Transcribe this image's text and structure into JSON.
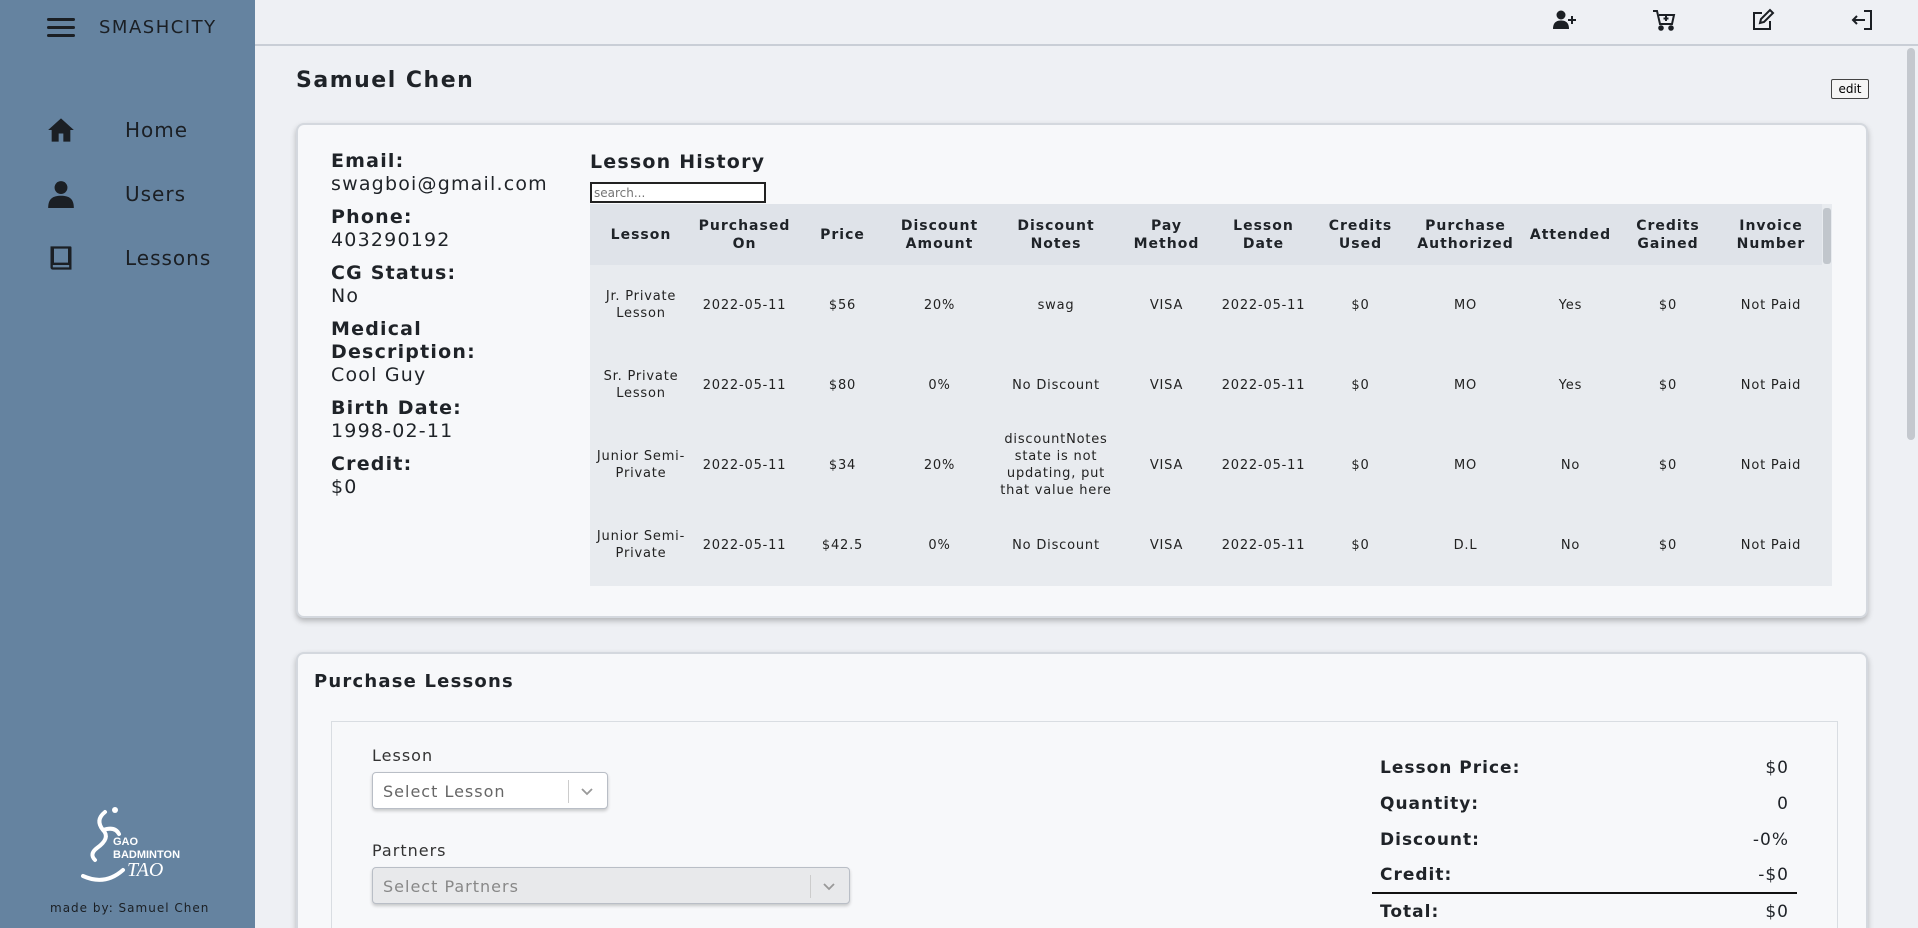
{
  "app": {
    "title": "SMASHCITY",
    "made_by": "made by: Samuel Chen"
  },
  "sidebar": {
    "items": [
      {
        "label": "Home",
        "icon": "home-icon"
      },
      {
        "label": "Users",
        "icon": "user-icon"
      },
      {
        "label": "Lessons",
        "icon": "book-icon"
      }
    ]
  },
  "topbar": {
    "icons": [
      "add-user-icon",
      "cart-icon",
      "edit-icon",
      "logout-icon"
    ]
  },
  "page": {
    "title": "Samuel Chen",
    "edit_label": "edit"
  },
  "user": {
    "fields": [
      {
        "label": "Email:",
        "value": "swagboi@gmail.com"
      },
      {
        "label": "Phone:",
        "value": "403290192"
      },
      {
        "label": "CG Status:",
        "value": "No"
      },
      {
        "label": "Medical Description:",
        "value": "Cool Guy"
      },
      {
        "label": "Birth Date:",
        "value": "1998-02-11"
      },
      {
        "label": "Credit:",
        "value": "$0"
      }
    ]
  },
  "history": {
    "title": "Lesson History",
    "search_placeholder": "search...",
    "columns": [
      "Lesson",
      "Purchased On",
      "Price",
      "Discount Amount",
      "Discount Notes",
      "Pay Method",
      "Lesson Date",
      "Credits Used",
      "Purchase Authorized",
      "Attended",
      "Credits Gained",
      "Invoice Number"
    ],
    "rows": [
      [
        "Jr. Private Lesson",
        "2022-05-11",
        "$56",
        "20%",
        "swag",
        "VISA",
        "2022-05-11",
        "$0",
        "MO",
        "Yes",
        "$0",
        "Not Paid"
      ],
      [
        "Sr. Private Lesson",
        "2022-05-11",
        "$80",
        "0%",
        "No Discount",
        "VISA",
        "2022-05-11",
        "$0",
        "MO",
        "Yes",
        "$0",
        "Not Paid"
      ],
      [
        "Junior Semi-Private",
        "2022-05-11",
        "$34",
        "20%",
        "discountNotes state is not updating, put that value here",
        "VISA",
        "2022-05-11",
        "$0",
        "MO",
        "No",
        "$0",
        "Not Paid"
      ],
      [
        "Junior Semi-Private",
        "2022-05-11",
        "$42.5",
        "0%",
        "No Discount",
        "VISA",
        "2022-05-11",
        "$0",
        "D.L",
        "No",
        "$0",
        "Not Paid"
      ]
    ]
  },
  "purchase": {
    "title": "Purchase Lessons",
    "lesson_label": "Lesson",
    "lesson_placeholder": "Select Lesson",
    "partners_label": "Partners",
    "partners_placeholder": "Select Partners",
    "summary": [
      {
        "label": "Lesson Price:",
        "value": "$0"
      },
      {
        "label": "Quantity:",
        "value": "0"
      },
      {
        "label": "Discount:",
        "value": "-0%"
      },
      {
        "label": "Credit:",
        "value": "-$0"
      },
      {
        "label": "Total:",
        "value": "$0"
      }
    ]
  }
}
